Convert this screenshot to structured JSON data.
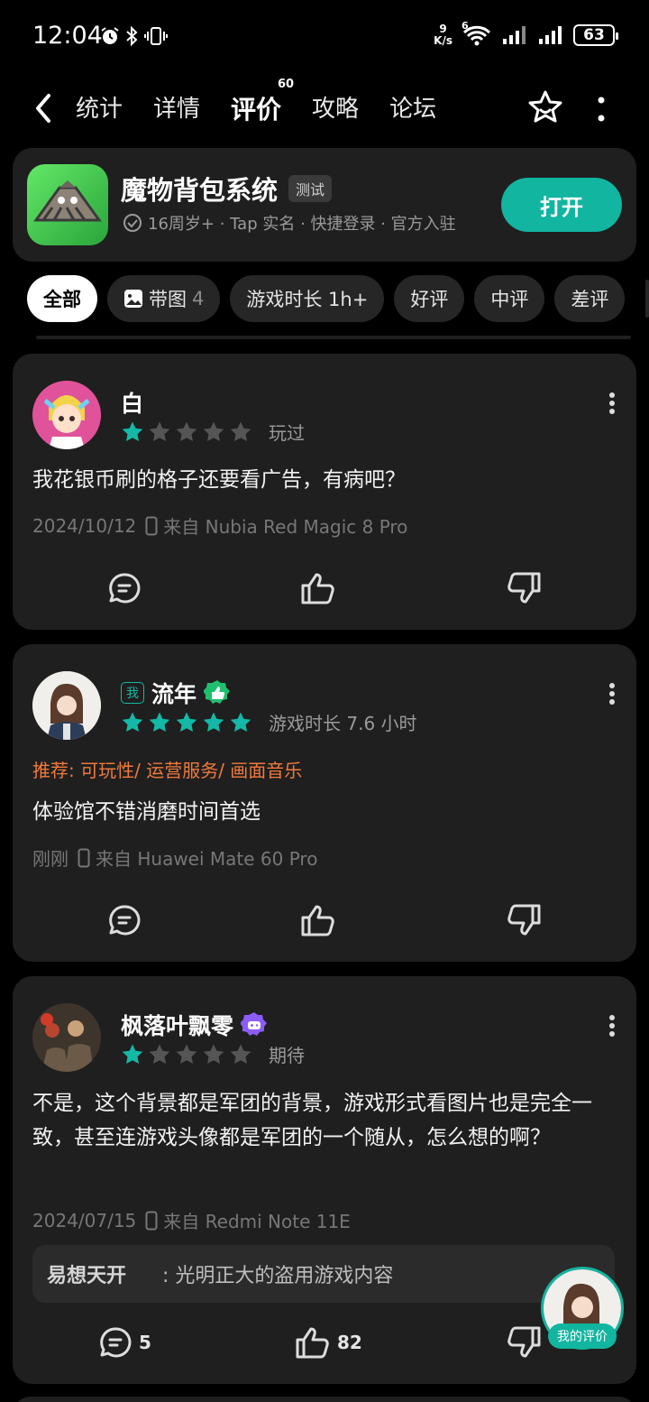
{
  "status_bar": {
    "time": "12:04",
    "net_speed_value": "9",
    "net_speed_unit": "K/s",
    "wifi_label": "6",
    "battery": "63"
  },
  "nav": {
    "tabs": [
      {
        "label": "统计"
      },
      {
        "label": "详情"
      },
      {
        "label": "评价",
        "badge": "60"
      },
      {
        "label": "攻略"
      },
      {
        "label": "论坛"
      }
    ]
  },
  "app": {
    "name": "魔物背包系统",
    "tag": "测试",
    "meta": "16周岁+ · Tap 实名 · 快捷登录 · 官方入驻",
    "open_label": "打开"
  },
  "filters": [
    {
      "label": "全部"
    },
    {
      "label": "带图",
      "count": "4"
    },
    {
      "label": "游戏时长 1h+"
    },
    {
      "label": "好评"
    },
    {
      "label": "中评"
    },
    {
      "label": "差评"
    }
  ],
  "reviews": [
    {
      "user": "白",
      "rating": 1,
      "status": "玩过",
      "content": "我花银币刷的格子还要看广告，有病吧？",
      "date": "2024/10/12",
      "device": "来自 Nubia Red Magic 8 Pro"
    },
    {
      "user": "流年",
      "me_tag": "我",
      "rating": 5,
      "status": "游戏时长 7.6 小时",
      "recommend": "推荐: 可玩性/ 运营服务/ 画面音乐",
      "content": "体验馆不错消磨时间首选",
      "date": "刚刚",
      "device": "来自 Huawei Mate 60 Pro"
    },
    {
      "user": "枫落叶飘零",
      "rating": 1,
      "status": "期待",
      "content": "不是，这个背景都是军团的背景，游戏形式看图片也是完全一致，甚至连游戏头像都是军团的一个随从，怎么想的啊？",
      "date": "2024/07/15",
      "device": "来自 Redmi Note 11E",
      "reply_user": "易想天开",
      "reply_text": ": 光明正大的盗用游戏内容",
      "comments": "5",
      "likes": "82"
    }
  ],
  "fab": {
    "label": "我的评价"
  },
  "colors": {
    "accent": "#12b5a0",
    "recommend": "#f07a3c",
    "card": "#1f1f1f",
    "bg": "#000000"
  }
}
